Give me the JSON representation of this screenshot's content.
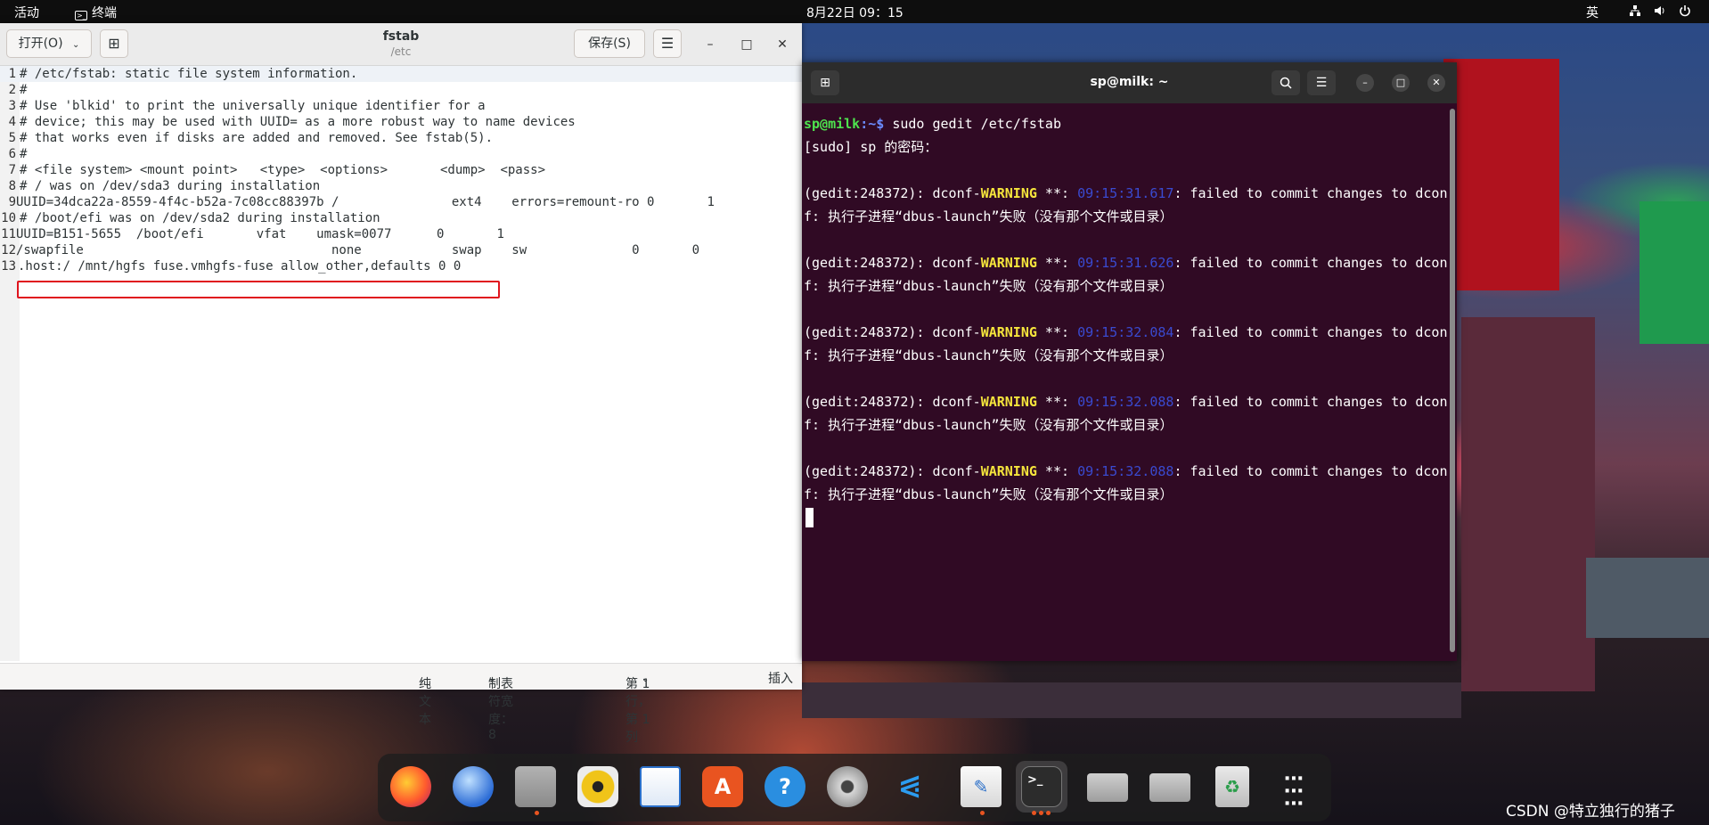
{
  "topbar": {
    "activities": "活动",
    "app_name": "终端",
    "clock": "8月22日  09：15",
    "input_method": "英"
  },
  "gedit": {
    "open_label": "打开(O)",
    "title": "fstab",
    "subtitle": "/etc",
    "save_label": "保存(S)",
    "lines": [
      {
        "n": "1",
        "t": "# /etc/fstab: static file system information."
      },
      {
        "n": "2",
        "t": "#"
      },
      {
        "n": "3",
        "t": "# Use 'blkid' to print the universally unique identifier for a"
      },
      {
        "n": "4",
        "t": "# device; this may be used with UUID= as a more robust way to name devices"
      },
      {
        "n": "5",
        "t": "# that works even if disks are added and removed. See fstab(5)."
      },
      {
        "n": "6",
        "t": "#"
      },
      {
        "n": "7",
        "t": "# <file system> <mount point>   <type>  <options>       <dump>  <pass>"
      },
      {
        "n": "8",
        "t": "# / was on /dev/sda3 during installation"
      },
      {
        "n": "9",
        "t": "UUID=34dca22a-8559-4f4c-b52a-7c08cc88397b /               ext4    errors=remount-ro 0       1"
      },
      {
        "n": "10",
        "t": "# /boot/efi was on /dev/sda2 during installation"
      },
      {
        "n": "11",
        "t": "UUID=B151-5655  /boot/efi       vfat    umask=0077      0       1"
      },
      {
        "n": "12",
        "t": "/swapfile                                 none            swap    sw              0       0"
      },
      {
        "n": "13",
        "t": ".host:/ /mnt/hgfs fuse.vmhgfs-fuse allow_other,defaults 0 0"
      }
    ],
    "status": {
      "lang": "纯文本",
      "tab_width": "制表符宽度：8",
      "position": "第 1 行，第 1 列",
      "mode": "插入"
    }
  },
  "terminal": {
    "title": "sp@milk: ~",
    "prompt_user": "sp@milk",
    "prompt_path": ":~$",
    "command": " sudo gedit /etc/fstab",
    "sudo_prompt": "[sudo] sp 的密码：",
    "warnings": [
      {
        "prefix": "(gedit:248372): dconf-",
        "level": "WARNING",
        "mid": " **: ",
        "time": "09:15:31.617",
        "msg": ": failed to commit changes to dcon",
        "cont": "f: 执行子进程“dbus-launch”失败（没有那个文件或目录）"
      },
      {
        "prefix": "(gedit:248372): dconf-",
        "level": "WARNING",
        "mid": " **: ",
        "time": "09:15:31.626",
        "msg": ": failed to commit changes to dcon",
        "cont": "f: 执行子进程“dbus-launch”失败（没有那个文件或目录）"
      },
      {
        "prefix": "(gedit:248372): dconf-",
        "level": "WARNING",
        "mid": " **: ",
        "time": "09:15:32.084",
        "msg": ": failed to commit changes to dcon",
        "cont": "f: 执行子进程“dbus-launch”失败（没有那个文件或目录）"
      },
      {
        "prefix": "(gedit:248372): dconf-",
        "level": "WARNING",
        "mid": " **: ",
        "time": "09:15:32.088",
        "msg": ": failed to commit changes to dcon",
        "cont": "f: 执行子进程“dbus-launch”失败（没有那个文件或目录）"
      },
      {
        "prefix": "(gedit:248372): dconf-",
        "level": "WARNING",
        "mid": " **: ",
        "time": "09:15:32.088",
        "msg": ": failed to commit changes to dcon",
        "cont": "f: 执行子进程“dbus-launch”失败（没有那个文件或目录）"
      }
    ]
  },
  "dock": {
    "apps": [
      "firefox-icon",
      "thunderbird-icon",
      "files-icon",
      "rhythmbox-icon",
      "writer-icon",
      "app-center-icon",
      "help-icon",
      "settings-icon",
      "vscode-icon",
      "text-editor-icon",
      "terminal-icon",
      "drive-icon",
      "drive-icon",
      "trash-icon",
      "show-apps-icon"
    ]
  },
  "watermark": "CSDN @特立独行的猪子"
}
